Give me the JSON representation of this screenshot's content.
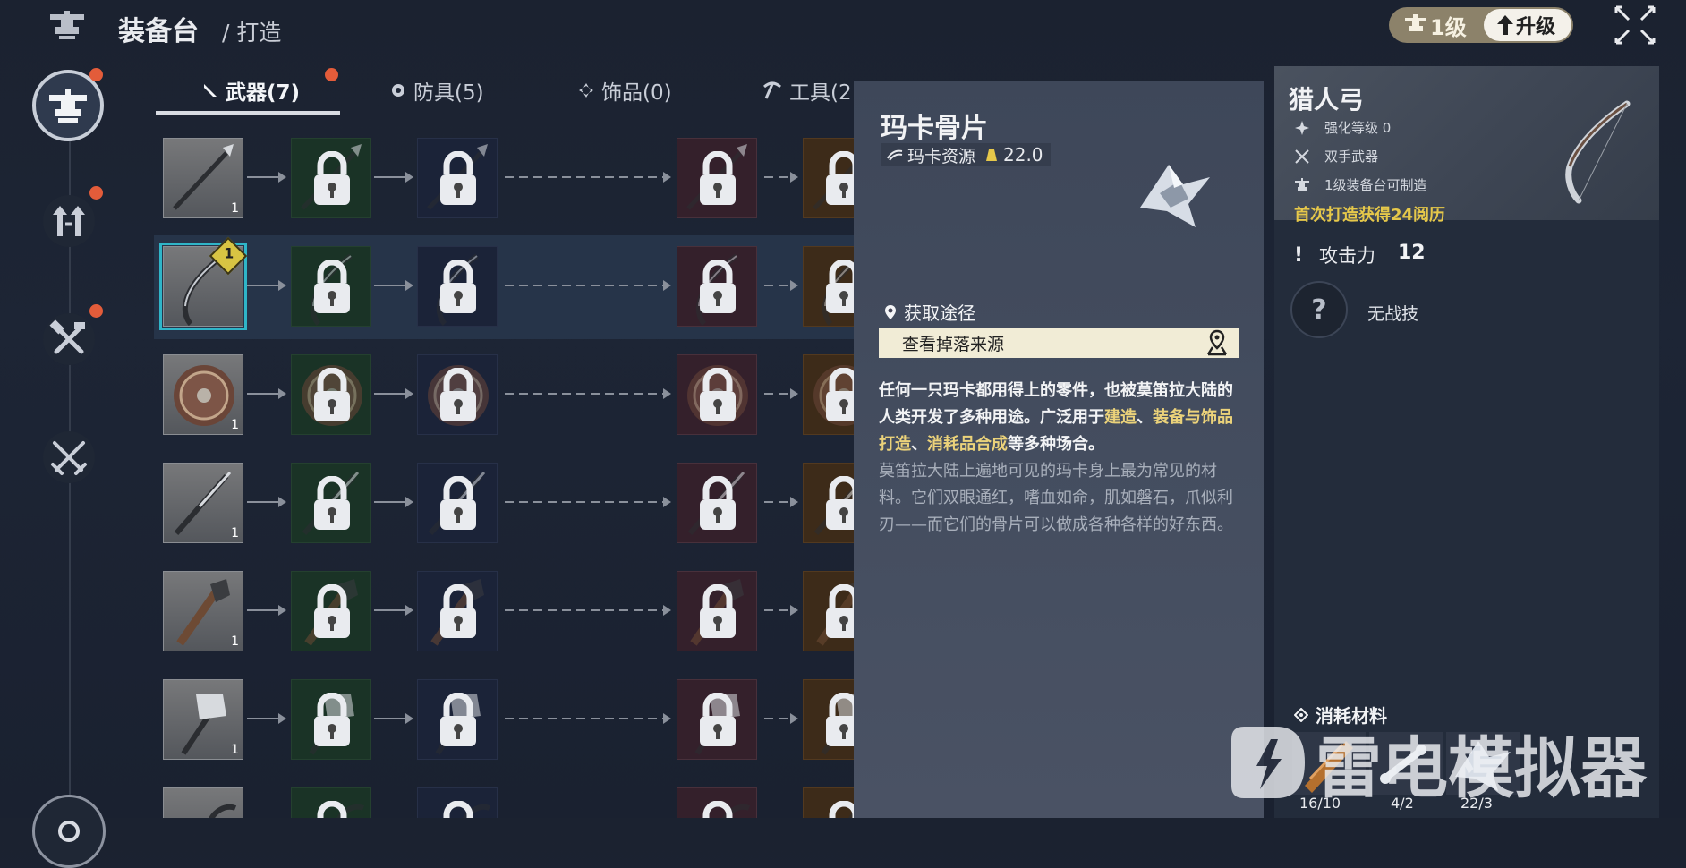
{
  "header": {
    "title": "装备台",
    "breadcrumb": "/ 打造",
    "level_label": "1级",
    "upgrade_label": "升级"
  },
  "tabs": [
    {
      "label": "武器(7)",
      "icon": "blade-icon",
      "active": true,
      "has_dot": true
    },
    {
      "label": "防具(5)",
      "icon": "shield-icon",
      "active": false
    },
    {
      "label": "饰品(0)",
      "icon": "diamond-icon",
      "active": false
    },
    {
      "label": "工具(2",
      "icon": "pickaxe-icon",
      "active": false
    }
  ],
  "grid": {
    "rows": [
      {
        "item": "spear",
        "qty": "1",
        "selected": false
      },
      {
        "item": "bow",
        "qty": "",
        "selected": true,
        "badge": "1"
      },
      {
        "item": "shield",
        "qty": "1",
        "selected": false
      },
      {
        "item": "blade",
        "qty": "1",
        "selected": false
      },
      {
        "item": "club",
        "qty": "1",
        "selected": false
      },
      {
        "item": "hammer",
        "qty": "1",
        "selected": false
      },
      {
        "item": "sickle",
        "qty": "",
        "selected": false
      }
    ]
  },
  "tooltip": {
    "name": "玛卡骨片",
    "tag": "玛卡资源",
    "weight": "22.0",
    "source_title": "获取途径",
    "source_button": "查看掉落来源",
    "desc_part1": "任何一只玛卡都用得上的零件，也被莫笛拉大陆的人类开发了多种用途。广泛用于",
    "desc_hl1": "建造",
    "desc_sep1": "、",
    "desc_hl2": "装备与饰品打造",
    "desc_sep2": "、",
    "desc_hl3": "消耗品合成",
    "desc_part2": "等多种场合。",
    "lore": "莫笛拉大陆上遍地可见的玛卡身上最为常见的材料。它们双眼通红，嗜血如命，肌如磐石，爪似利刃——而它们的骨片可以做成各种各样的好东西。"
  },
  "item": {
    "name": "猎人弓",
    "stats": [
      "强化等级 0",
      "双手武器",
      "1级装备台可制造"
    ],
    "first_craft": "首次打造获得24阅历",
    "attack_label": "攻击力",
    "attack_value": "12",
    "skill_icon": "?",
    "skill_text": "无战技",
    "materials_label": "消耗材料",
    "materials": [
      {
        "name": "wood-material",
        "count": "16/10"
      },
      {
        "name": "bone-material",
        "count": "4/2"
      },
      {
        "name": "maka-bone-material",
        "count": "22/3"
      }
    ]
  },
  "watermark": "雷电模拟器",
  "colors": {
    "accent_selected": "#2fb5c8",
    "notification": "#e35c3a",
    "highlight_gold": "#e6c84a"
  }
}
